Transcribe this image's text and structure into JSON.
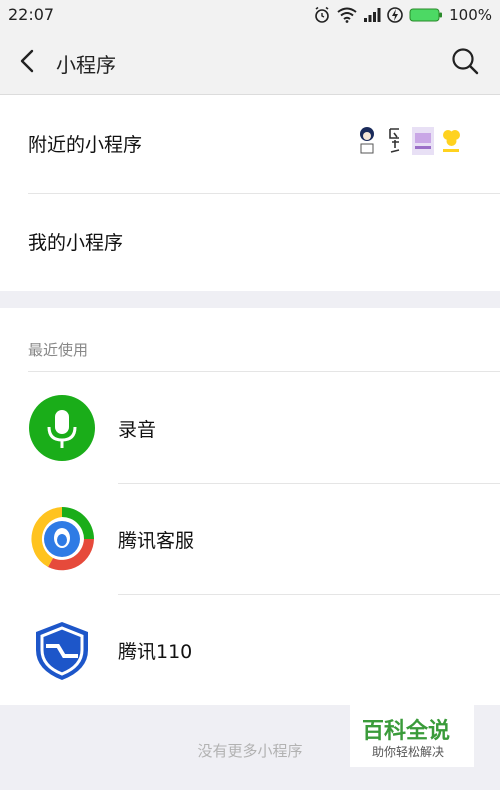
{
  "status": {
    "time": "22:07",
    "battery": "100%"
  },
  "nav": {
    "title": "小程序"
  },
  "menu": {
    "nearby": "附近的小程序",
    "mine": "我的小程序"
  },
  "recent": {
    "title": "最近使用",
    "apps": [
      {
        "name": "录音",
        "icon": "microphone-icon"
      },
      {
        "name": "腾讯客服",
        "icon": "tencent-service-icon"
      },
      {
        "name": "腾讯110",
        "icon": "shield-icon"
      }
    ]
  },
  "footer": {
    "text": "没有更多小程序"
  },
  "watermark": {
    "main": "百科全说",
    "sub": "助你轻松解决"
  },
  "colors": {
    "green": "#1aad19",
    "accent": "#3a9b3a"
  }
}
